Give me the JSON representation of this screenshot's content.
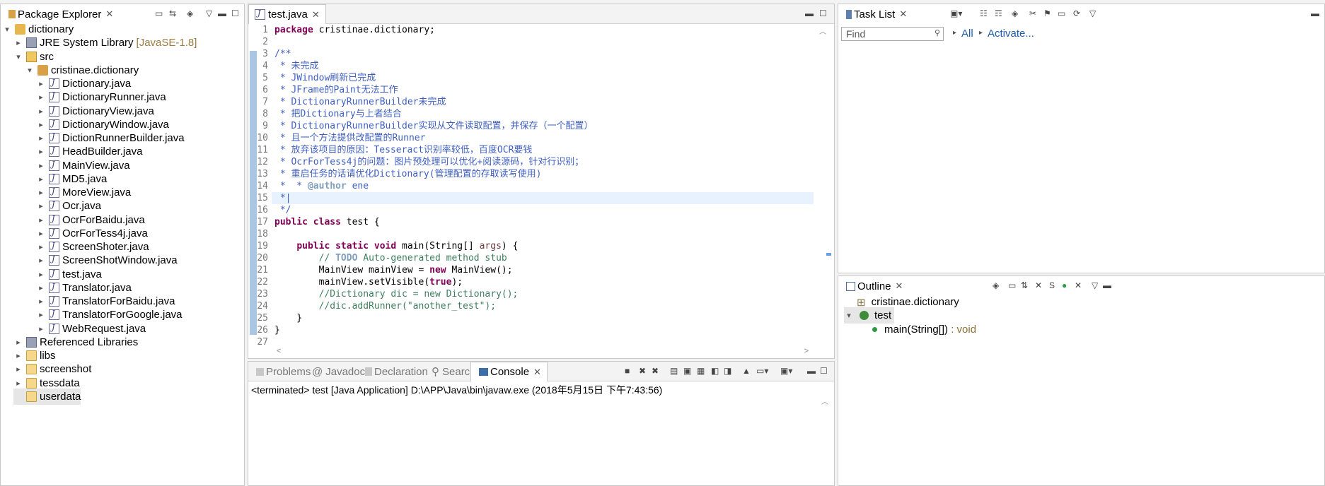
{
  "package_explorer": {
    "title": "Package Explorer",
    "rows": [
      {
        "label": "dictionary",
        "arrow": "▾",
        "icon": "project-icon",
        "meta": ""
      },
      {
        "label": "JRE System Library",
        "arrow": "▸",
        "icon": "library-icon",
        "meta": "[JavaSE-1.8]"
      },
      {
        "label": "src",
        "arrow": "▾",
        "icon": "source-folder-icon",
        "meta": ""
      },
      {
        "label": "cristinae.dictionary",
        "arrow": "▾",
        "icon": "package-icon",
        "meta": ""
      },
      {
        "label": "Dictionary.java",
        "arrow": "▸",
        "icon": "java-file-icon",
        "meta": ""
      },
      {
        "label": "DictionaryRunner.java",
        "arrow": "▸",
        "icon": "java-file-icon",
        "meta": ""
      },
      {
        "label": "DictionaryView.java",
        "arrow": "▸",
        "icon": "java-file-icon",
        "meta": ""
      },
      {
        "label": "DictionaryWindow.java",
        "arrow": "▸",
        "icon": "java-file-icon",
        "meta": ""
      },
      {
        "label": "DictionRunnerBuilder.java",
        "arrow": "▸",
        "icon": "java-file-icon",
        "meta": ""
      },
      {
        "label": "HeadBuilder.java",
        "arrow": "▸",
        "icon": "java-file-icon",
        "meta": ""
      },
      {
        "label": "MainView.java",
        "arrow": "▸",
        "icon": "java-file-icon",
        "meta": ""
      },
      {
        "label": "MD5.java",
        "arrow": "▸",
        "icon": "java-file-icon",
        "meta": ""
      },
      {
        "label": "MoreView.java",
        "arrow": "▸",
        "icon": "java-file-icon",
        "meta": ""
      },
      {
        "label": "Ocr.java",
        "arrow": "▸",
        "icon": "java-file-icon",
        "meta": ""
      },
      {
        "label": "OcrForBaidu.java",
        "arrow": "▸",
        "icon": "java-file-icon",
        "meta": ""
      },
      {
        "label": "OcrForTess4j.java",
        "arrow": "▸",
        "icon": "java-file-icon",
        "meta": ""
      },
      {
        "label": "ScreenShoter.java",
        "arrow": "▸",
        "icon": "java-file-icon",
        "meta": ""
      },
      {
        "label": "ScreenShotWindow.java",
        "arrow": "▸",
        "icon": "java-file-icon",
        "meta": ""
      },
      {
        "label": "test.java",
        "arrow": "▸",
        "icon": "java-file-icon",
        "meta": ""
      },
      {
        "label": "Translator.java",
        "arrow": "▸",
        "icon": "java-file-icon",
        "meta": ""
      },
      {
        "label": "TranslatorForBaidu.java",
        "arrow": "▸",
        "icon": "java-file-icon",
        "meta": ""
      },
      {
        "label": "TranslatorForGoogle.java",
        "arrow": "▸",
        "icon": "java-file-icon",
        "meta": ""
      },
      {
        "label": "WebRequest.java",
        "arrow": "▸",
        "icon": "java-file-icon",
        "meta": ""
      },
      {
        "label": "Referenced Libraries",
        "arrow": "▸",
        "icon": "library-icon",
        "meta": ""
      },
      {
        "label": "libs",
        "arrow": "▸",
        "icon": "folder-icon",
        "meta": ""
      },
      {
        "label": "screenshot",
        "arrow": "▸",
        "icon": "folder-icon",
        "meta": ""
      },
      {
        "label": "tessdata",
        "arrow": "▸",
        "icon": "folder-icon",
        "meta": ""
      },
      {
        "label": "userdata",
        "arrow": "",
        "icon": "folder-icon",
        "meta": ""
      }
    ]
  },
  "editor": {
    "tab": "test.java",
    "line_numbers": [
      "1",
      "2",
      "3",
      "4",
      "5",
      "6",
      "7",
      "8",
      "9",
      "10",
      "11",
      "12",
      "13",
      "14",
      "15",
      "16",
      "17",
      "18",
      "19",
      "20",
      "21",
      "22",
      "23",
      "24",
      "25",
      "26",
      "27"
    ]
  },
  "bottom": {
    "tabs": [
      "Problems",
      "Javadoc",
      "Declaration",
      "Search",
      "Console"
    ],
    "console_text": "<terminated> test [Java Application] D:\\APP\\Java\\bin\\javaw.exe (2018年5月15日 下午7:43:56)"
  },
  "task_list": {
    "title": "Task List",
    "find_placeholder": "Find",
    "all": "All",
    "activate": "Activate..."
  },
  "outline": {
    "title": "Outline",
    "package": "cristinae.dictionary",
    "class": "test",
    "method": "main(String[])",
    "method_type": " : void"
  }
}
